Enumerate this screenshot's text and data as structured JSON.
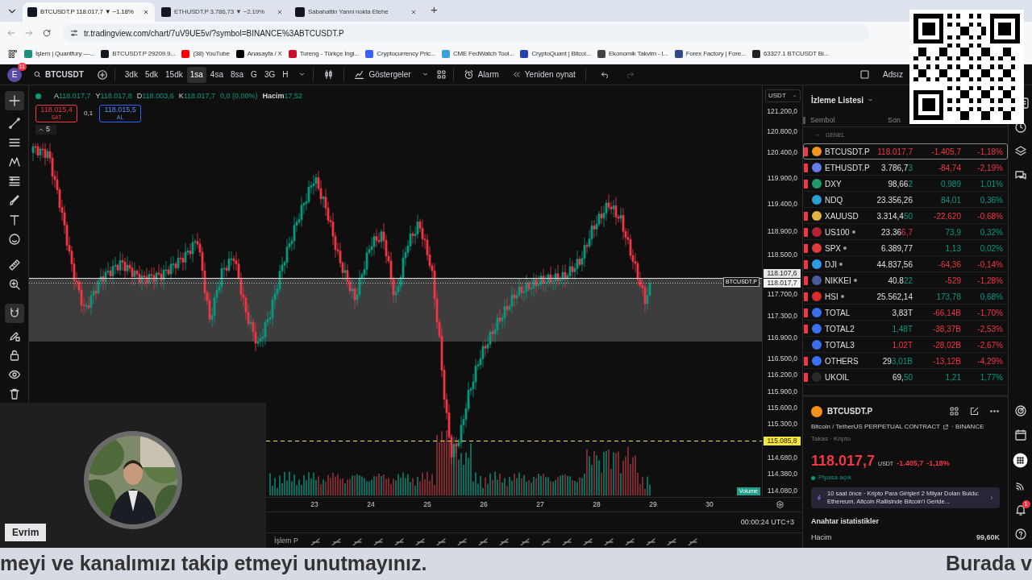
{
  "browser": {
    "tabs": [
      {
        "title": "BTCUSDT.P 118.017,7 ▼ −1.18%",
        "selected": true
      },
      {
        "title": "ETHUSDT.P 3.786,73 ▼ −2.19%",
        "selected": false
      },
      {
        "title": "Sabahattin Yanni nokta Etehe",
        "selected": false
      }
    ],
    "new_tab": "+",
    "address": "tr.tradingview.com/chart/7uV9UE5v/?symbol=BINANCE%3ABTCUSDT.P",
    "bookmarks": [
      {
        "label": "İşlem | Quantfury —...",
        "color": "#1b8f7e"
      },
      {
        "label": "BTCUSDT.P 29209.9...",
        "color": "#131722"
      },
      {
        "label": "(38) YouTube",
        "color": "#ff0000"
      },
      {
        "label": "Anasayfa / X",
        "color": "#000000"
      },
      {
        "label": "Tureng - Türkçe İngi...",
        "color": "#c8102e"
      },
      {
        "label": "Cryptocurrency Pric...",
        "color": "#3861fb"
      },
      {
        "label": "CME FedWatch Tool...",
        "color": "#3aa0d8"
      },
      {
        "label": "CryptoQuant | Bitcoi...",
        "color": "#2541b2"
      },
      {
        "label": "Ekonomik Takvim - I...",
        "color": "#444444"
      },
      {
        "label": "Forex Factory | Fore...",
        "color": "#2c4a8a"
      },
      {
        "label": "63327.1 BTCUSDT Bi...",
        "color": "#222222"
      }
    ]
  },
  "toolbar": {
    "avatar": "E",
    "notifications": "11",
    "symbol": "BTCUSDT",
    "intervals": [
      {
        "label": "3dk",
        "selected": false
      },
      {
        "label": "5dk",
        "selected": false
      },
      {
        "label": "15dk",
        "selected": false
      },
      {
        "label": "1sa",
        "selected": true
      },
      {
        "label": "4sa",
        "selected": false
      },
      {
        "label": "8sa",
        "selected": false
      },
      {
        "label": "G",
        "selected": false
      },
      {
        "label": "3G",
        "selected": false
      },
      {
        "label": "H",
        "selected": false
      }
    ],
    "indicators": "Göstergeler",
    "alert": "Alarm",
    "replay": "Yeniden oynat",
    "layout_name": "Adsız"
  },
  "legend": {
    "ohlc": [
      {
        "label": "A",
        "value": "118.017,7"
      },
      {
        "label": "Y",
        "value": "118.017,8"
      },
      {
        "label": "D",
        "value": "118.003,6"
      },
      {
        "label": "K",
        "value": "118.017,7"
      }
    ],
    "change": "0,0 (0,00%)",
    "volume_label": "Hacim",
    "volume": "17,52",
    "sell_price": "118.015,4",
    "sell_label": "SAT",
    "spread": "0,1",
    "buy_price": "118.015,5",
    "buy_label": "AL",
    "indicator_count": "5"
  },
  "chart": {
    "currency": "USDT",
    "price_labels": [
      "121.200,0",
      "120.800,0",
      "120.400,0",
      "119.900,0",
      "119.400,0",
      "118.900,0",
      "118.500,0",
      "117.700,0",
      "117.300,0",
      "116.900,0",
      "116.500,0",
      "116.200,0",
      "115.900,0",
      "115.600,0",
      "115.300,0",
      "114.680,0",
      "114.380,0",
      "114.080,0"
    ],
    "price_tags": [
      {
        "value": "118.107,6",
        "kind": "high"
      },
      {
        "value": "118.017,7",
        "kind": "last"
      },
      {
        "value": "115.085,8",
        "kind": "alert"
      }
    ],
    "line_label": "BTCUSDT.P",
    "volume_badge": "Volume",
    "time_labels": [
      "23",
      "24",
      "25",
      "26",
      "27",
      "28",
      "29",
      "30"
    ],
    "clock": "00:00:24 UTC+3",
    "bottom_tab": "İşlem P"
  },
  "watchlist": {
    "title": "İzleme Listesi",
    "columns": [
      "Sembol",
      "Son"
    ],
    "group": "GENEL",
    "rows": [
      {
        "symbol": "BTCUSDT.P",
        "last_tail": "118.017,7",
        "tail_gain": false,
        "change": "-1.405,7",
        "pct": "-1,18%",
        "gain": false,
        "flagged": true,
        "closed": false,
        "selected": true,
        "color": "#f7931a"
      },
      {
        "symbol": "ETHUSDT.P",
        "last_head": "3.786,7",
        "last_tail": "3",
        "tail_gain": true,
        "change": "-84,74",
        "pct": "-2,19%",
        "gain": false,
        "flagged": true,
        "closed": false,
        "selected": false,
        "color": "#627eea"
      },
      {
        "symbol": "DXY",
        "last_head": "98,66",
        "last_tail": "2",
        "tail_gain": true,
        "change": "0,989",
        "pct": "1,01%",
        "gain": true,
        "flagged": true,
        "closed": false,
        "selected": false,
        "color": "#1e9b6e"
      },
      {
        "symbol": "NDQ",
        "last_head": "23.356,26",
        "change": "84,01",
        "pct": "0,36%",
        "gain": true,
        "flagged": false,
        "closed": false,
        "selected": false,
        "color": "#2a9fd6"
      },
      {
        "symbol": "XAUUSD",
        "last_head": "3.314,4",
        "last_tail": "50",
        "tail_gain": true,
        "change": "-22,620",
        "pct": "-0,68%",
        "gain": false,
        "flagged": true,
        "closed": false,
        "selected": false,
        "color": "#e3b341"
      },
      {
        "symbol": "US100",
        "last_head": "23.36",
        "last_tail": "6,7",
        "tail_gain": false,
        "change": "73,9",
        "pct": "0,32%",
        "gain": true,
        "flagged": true,
        "closed": true,
        "selected": false,
        "color": "#b22234"
      },
      {
        "symbol": "SPX",
        "last_head": "6.389,77",
        "change": "1,13",
        "pct": "0,02%",
        "gain": true,
        "flagged": true,
        "closed": true,
        "selected": false,
        "color": "#e03c3c"
      },
      {
        "symbol": "DJI",
        "last_head": "44.837,56",
        "change": "-64,36",
        "pct": "-0,14%",
        "gain": false,
        "flagged": true,
        "closed": true,
        "selected": false,
        "color": "#2e9be6"
      },
      {
        "symbol": "NIKKEI",
        "last_head": "40.8",
        "last_tail": "22",
        "tail_gain": true,
        "change": "-529",
        "pct": "-1,28%",
        "gain": false,
        "flagged": true,
        "closed": true,
        "selected": false,
        "color": "#4a5a9a"
      },
      {
        "symbol": "HSI",
        "last_head": "25.562,14",
        "change": "173,78",
        "pct": "0,68%",
        "gain": true,
        "flagged": true,
        "closed": true,
        "selected": false,
        "color": "#d92b2b"
      },
      {
        "symbol": "TOTAL",
        "last_head": "3,83T",
        "change": "-66,14B",
        "pct": "-1,70%",
        "gain": false,
        "flagged": true,
        "closed": false,
        "selected": false,
        "color": "#3a6ff0"
      },
      {
        "symbol": "TOTAL2",
        "last_tail": "1,48T",
        "tail_gain": true,
        "change": "-38,37B",
        "pct": "-2,53%",
        "gain": false,
        "flagged": true,
        "closed": false,
        "selected": false,
        "color": "#3a6ff0"
      },
      {
        "symbol": "TOTAL3",
        "last_tail": "1,02T",
        "tail_gain": false,
        "change": "-28,02B",
        "pct": "-2,67%",
        "gain": false,
        "flagged": false,
        "closed": false,
        "selected": false,
        "color": "#3a6ff0"
      },
      {
        "symbol": "OTHERS",
        "last_head": "29",
        "last_tail": "3,01B",
        "tail_gain": true,
        "change": "-13,12B",
        "pct": "-4,29%",
        "gain": false,
        "flagged": true,
        "closed": false,
        "selected": false,
        "color": "#3a6ff0"
      },
      {
        "symbol": "UKOIL",
        "last_head": "69,",
        "last_tail": "50",
        "tail_gain": true,
        "change": "1,21",
        "pct": "1,77%",
        "gain": true,
        "flagged": true,
        "closed": false,
        "selected": false,
        "color": "#2a2a2a"
      }
    ]
  },
  "details": {
    "symbol": "BTCUSDT.P",
    "description": "Bitcoin / TetherUS PERPETUAL CONTRACT",
    "exchange": "· BINANCE",
    "category": "Takas · Kripto",
    "price": "118.017,7",
    "currency": "USDT",
    "change": "-1.405,7",
    "change_pct": "-1,18%",
    "gain": false,
    "market_status": "Piyasa açık",
    "market_open": true,
    "news": "10 saat önce · Kripto Para Girişleri 2 Milyar Doları Buldu: Ethereum, Altcoin Rallisinde Bitcoin'i Geride...",
    "stats_title": "Anahtar istatistikler",
    "stats": [
      {
        "label": "Hacim",
        "value": "99,60K"
      }
    ]
  },
  "sidebar": {
    "notification_badge": "1"
  },
  "webcam": {
    "name": "Evrim"
  },
  "subtitles": [
    "meyi ve kanalımızı takip etmeyi unutmayınız.",
    "Burada v"
  ]
}
